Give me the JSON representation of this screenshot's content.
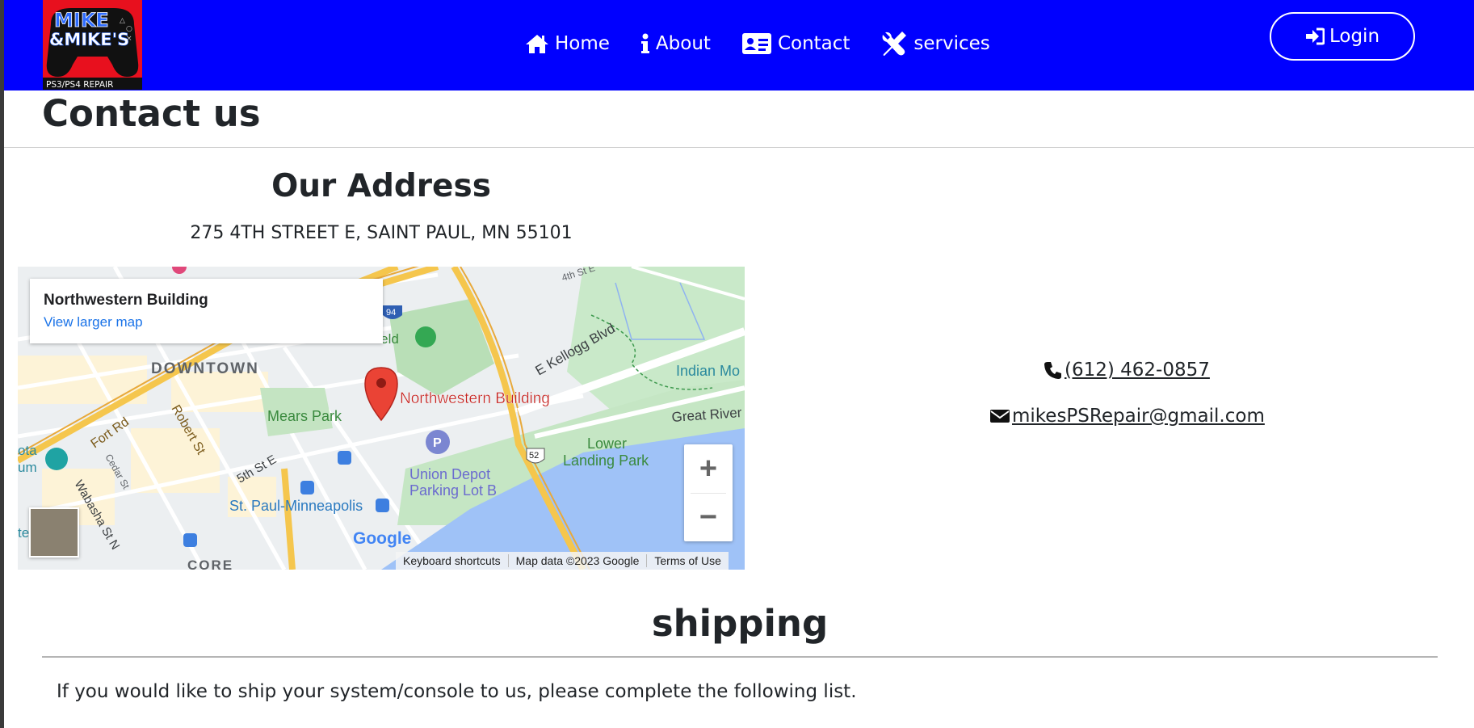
{
  "header": {
    "logo": {
      "top_text": "MIKE",
      "mid_text": "&MIKE'S",
      "bottom_text": "PS3/PS4 REPAIR",
      "icon": "gamepad-logo",
      "bg_color": "#e8101e"
    },
    "nav": [
      {
        "label": "Home",
        "icon": "home-icon"
      },
      {
        "label": "About",
        "icon": "info-icon"
      },
      {
        "label": "Contact",
        "icon": "id-card-icon"
      },
      {
        "label": "services",
        "icon": "tools-icon"
      }
    ],
    "login_label": "Login",
    "bg_color": "#0000ff"
  },
  "page": {
    "title": "Contact us"
  },
  "address": {
    "heading": "Our Address",
    "text": "275 4TH STREET E, SAINT PAUL, MN 55101"
  },
  "map": {
    "card_title": "Northwestern Building",
    "card_link": "View larger map",
    "pin_label": "Northwestern Building",
    "labels": {
      "downtown": "DOWNTOWN",
      "mears_park": "Mears Park",
      "kellogg": "E Kellogg Blvd",
      "indian": "Indian Mo",
      "great_river": "Great River",
      "lower_landing": "Lower",
      "lower_landing2": "Landing Park",
      "union_depot": "Union Depot",
      "union_depot2": "Parking Lot B",
      "st_paul_mpls": "St. Paul-Minneapolis",
      "fifth_st": "5th St E",
      "fort_rd": "Fort Rd",
      "robert_st": "Robert St",
      "cedar_st": "Cedar St",
      "wabasha": "Wabasha St N",
      "fourth_st": "4th St E",
      "core": "CORE",
      "field": "Field",
      "route_52": "52",
      "route_94": "94",
      "ota": "ota",
      "um": "um",
      "te": "te"
    },
    "google": "Google",
    "footer": [
      "Keyboard shortcuts",
      "Map data ©2023 Google",
      "Terms of Use"
    ],
    "zoom_in": "+",
    "zoom_out": "−"
  },
  "contact": {
    "phone": "(612) 462-0857",
    "email": "mikesPSRepair@gmail.com"
  },
  "shipping": {
    "heading": "shipping",
    "text": "If you would like to ship your system/console to us, please complete the following list."
  }
}
